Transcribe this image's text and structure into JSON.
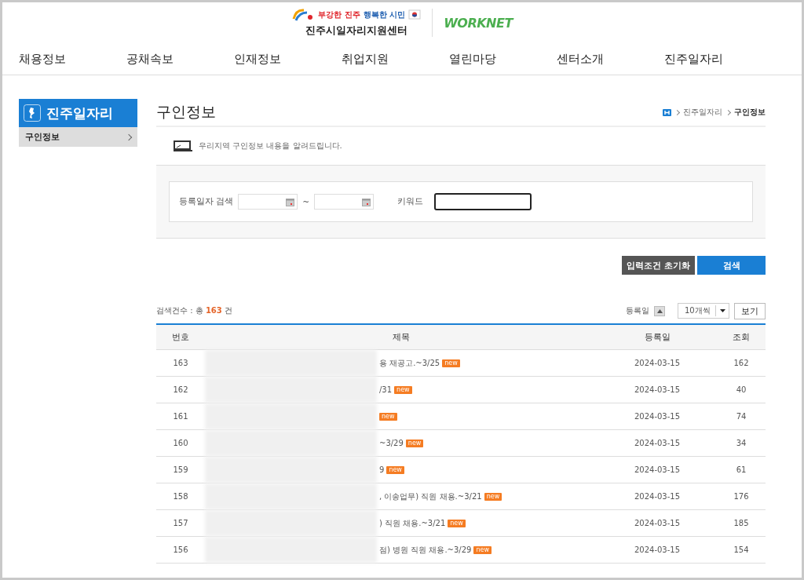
{
  "header": {
    "slogan": [
      {
        "text": "부강한 진주",
        "color": "#e0262c"
      },
      {
        "text": "행복한 시민",
        "color": "#1f5fb0"
      }
    ],
    "center_name": "진주시일자리지원센터",
    "partner_logo": "WORKNET"
  },
  "nav": [
    "채용정보",
    "공채속보",
    "인재정보",
    "취업지원",
    "열린마당",
    "센터소개",
    "진주일자리"
  ],
  "sidebar": {
    "title": "진주일자리",
    "items": [
      {
        "label": "구인정보",
        "selected": true
      }
    ]
  },
  "page": {
    "title": "구인정보",
    "breadcrumb": [
      "진주일자리",
      "구인정보"
    ],
    "intro": "우리지역 구인정보 내용을 알려드립니다."
  },
  "search": {
    "date_label": "등록일자 검색",
    "range_sep": "~",
    "keyword_label": "키워드",
    "keyword_focused": true,
    "reset_button": "입력조건 초기화",
    "search_button": "검색"
  },
  "results": {
    "count_prefix": "검색건수 : 총",
    "count": "163",
    "count_suffix": "건",
    "sort_label": "등록일",
    "page_size": "10개씩",
    "view_button": "보기"
  },
  "table": {
    "columns": [
      "번호",
      "제목",
      "등록일",
      "조회"
    ],
    "rows": [
      {
        "number": "163",
        "title": "용 재공고.~3/25",
        "badge": "new",
        "date": "2024-03-15",
        "views": "162"
      },
      {
        "number": "162",
        "title": "/31",
        "badge": "new",
        "date": "2024-03-15",
        "views": "40"
      },
      {
        "number": "161",
        "badge": "new",
        "date": "2024-03-15",
        "views": "74"
      },
      {
        "number": "160",
        "title": "~3/29",
        "badge": "new",
        "date": "2024-03-15",
        "views": "34"
      },
      {
        "number": "159",
        "title": "9",
        "badge": "new",
        "date": "2024-03-15",
        "views": "61"
      },
      {
        "number": "158",
        "title": ", 이송업무) 직원 채용.~3/21",
        "badge": "new",
        "date": "2024-03-15",
        "views": "176"
      },
      {
        "number": "157",
        "title": ") 직원 채용.~3/21",
        "badge": "new",
        "date": "2024-03-15",
        "views": "185"
      },
      {
        "number": "156",
        "title": "점) 병원 직원 채용.~3/29",
        "badge": "new",
        "date": "2024-03-15",
        "views": "154"
      }
    ]
  }
}
